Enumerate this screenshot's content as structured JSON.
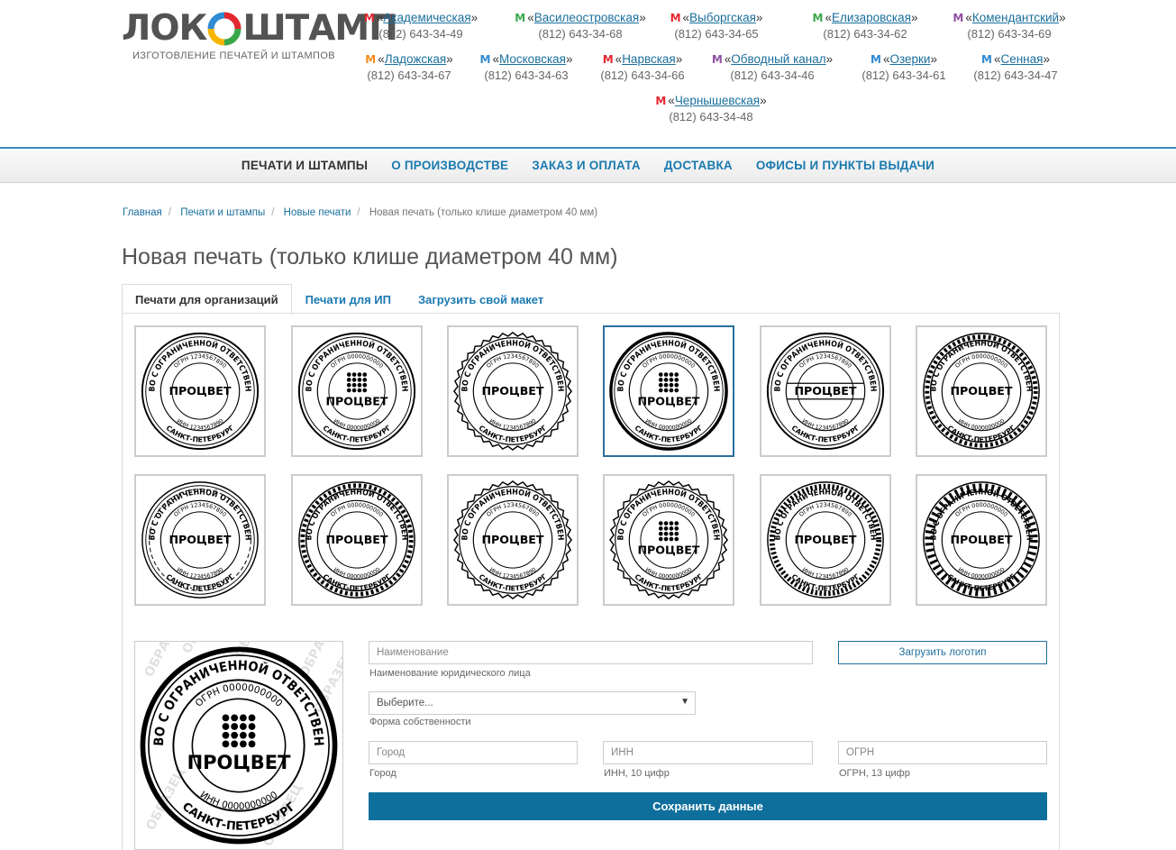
{
  "brand": {
    "name_left": "ЛОК",
    "name_right": "ШТАМП",
    "tagline": "ИЗГОТОВЛЕНИЕ ПЕЧАТЕЙ И ШТАМПОВ"
  },
  "metro_letter": "M",
  "stations": [
    {
      "name": "Академическая",
      "phone": "(812) 643-34-49",
      "color": "#e4262e"
    },
    {
      "name": "Василеостровская",
      "phone": "(812) 643-34-68",
      "color": "#3aa74a"
    },
    {
      "name": "Выборгская",
      "phone": "(812) 643-34-65",
      "color": "#e4262e"
    },
    {
      "name": "Елизаровская",
      "phone": "(812) 643-34-62",
      "color": "#3aa74a"
    },
    {
      "name": "Комендантский",
      "phone": "(812) 643-34-69",
      "color": "#8e4fa2"
    },
    {
      "name": "Ладожская",
      "phone": "(812) 643-34-67",
      "color": "#f28b1c"
    },
    {
      "name": "Московская",
      "phone": "(812) 643-34-63",
      "color": "#2f8bd2"
    },
    {
      "name": "Нарвская",
      "phone": "(812) 643-34-66",
      "color": "#e4262e"
    },
    {
      "name": "Обводный канал",
      "phone": "(812) 643-34-46",
      "color": "#8e4fa2"
    },
    {
      "name": "Озерки",
      "phone": "(812) 643-34-61",
      "color": "#2f8bd2"
    },
    {
      "name": "Сенная",
      "phone": "(812) 643-34-47",
      "color": "#2f8bd2"
    },
    {
      "name": "Чернышевская",
      "phone": "(812) 643-34-48",
      "color": "#e4262e"
    }
  ],
  "nav": [
    "ПЕЧАТИ И ШТАМПЫ",
    "О ПРОИЗВОДСТВЕ",
    "ЗАКАЗ И ОПЛАТА",
    "ДОСТАВКА",
    "ОФИСЫ И ПУНКТЫ ВЫДАЧИ"
  ],
  "breadcrumb": [
    "Главная",
    "Печати и штампы",
    "Новые печати",
    "Новая печать (только клише диаметром 40 мм)"
  ],
  "page_title": "Новая печать (только клише диаметром 40 мм)",
  "tabs": [
    "Печати для организаций",
    "Печати для ИП",
    "Загрузить свой макет"
  ],
  "stamp": {
    "org_type": "ОБЩЕСТВО С ОГРАНИЧЕННОЙ ОТВЕТСТВЕННОСТЬЮ",
    "name": "ПРОЦВЕТ",
    "city": "САНКТ-ПЕТЕРБУРГ",
    "ogrn_a": "ОГРН 1234567890",
    "inn_a": "ИНН 1234567890",
    "ogrn_b": "ОГРН 0000000000",
    "inn_b": "ИНН 0000000000",
    "watermark": "ОБРАЗЕЦ"
  },
  "form": {
    "name_placeholder": "Наименование",
    "name_hint": "Наименование юридического лица",
    "ownership_value": "Выберите...",
    "ownership_hint": "Форма собственности",
    "city_placeholder": "Город",
    "city_hint": "Город",
    "inn_placeholder": "ИНН",
    "inn_hint": "ИНН, 10 цифр",
    "ogrn_placeholder": "ОГРН",
    "ogrn_hint": "ОГРН, 13 цифр",
    "upload_logo": "Загрузить логотип",
    "save": "Сохранить данные"
  }
}
